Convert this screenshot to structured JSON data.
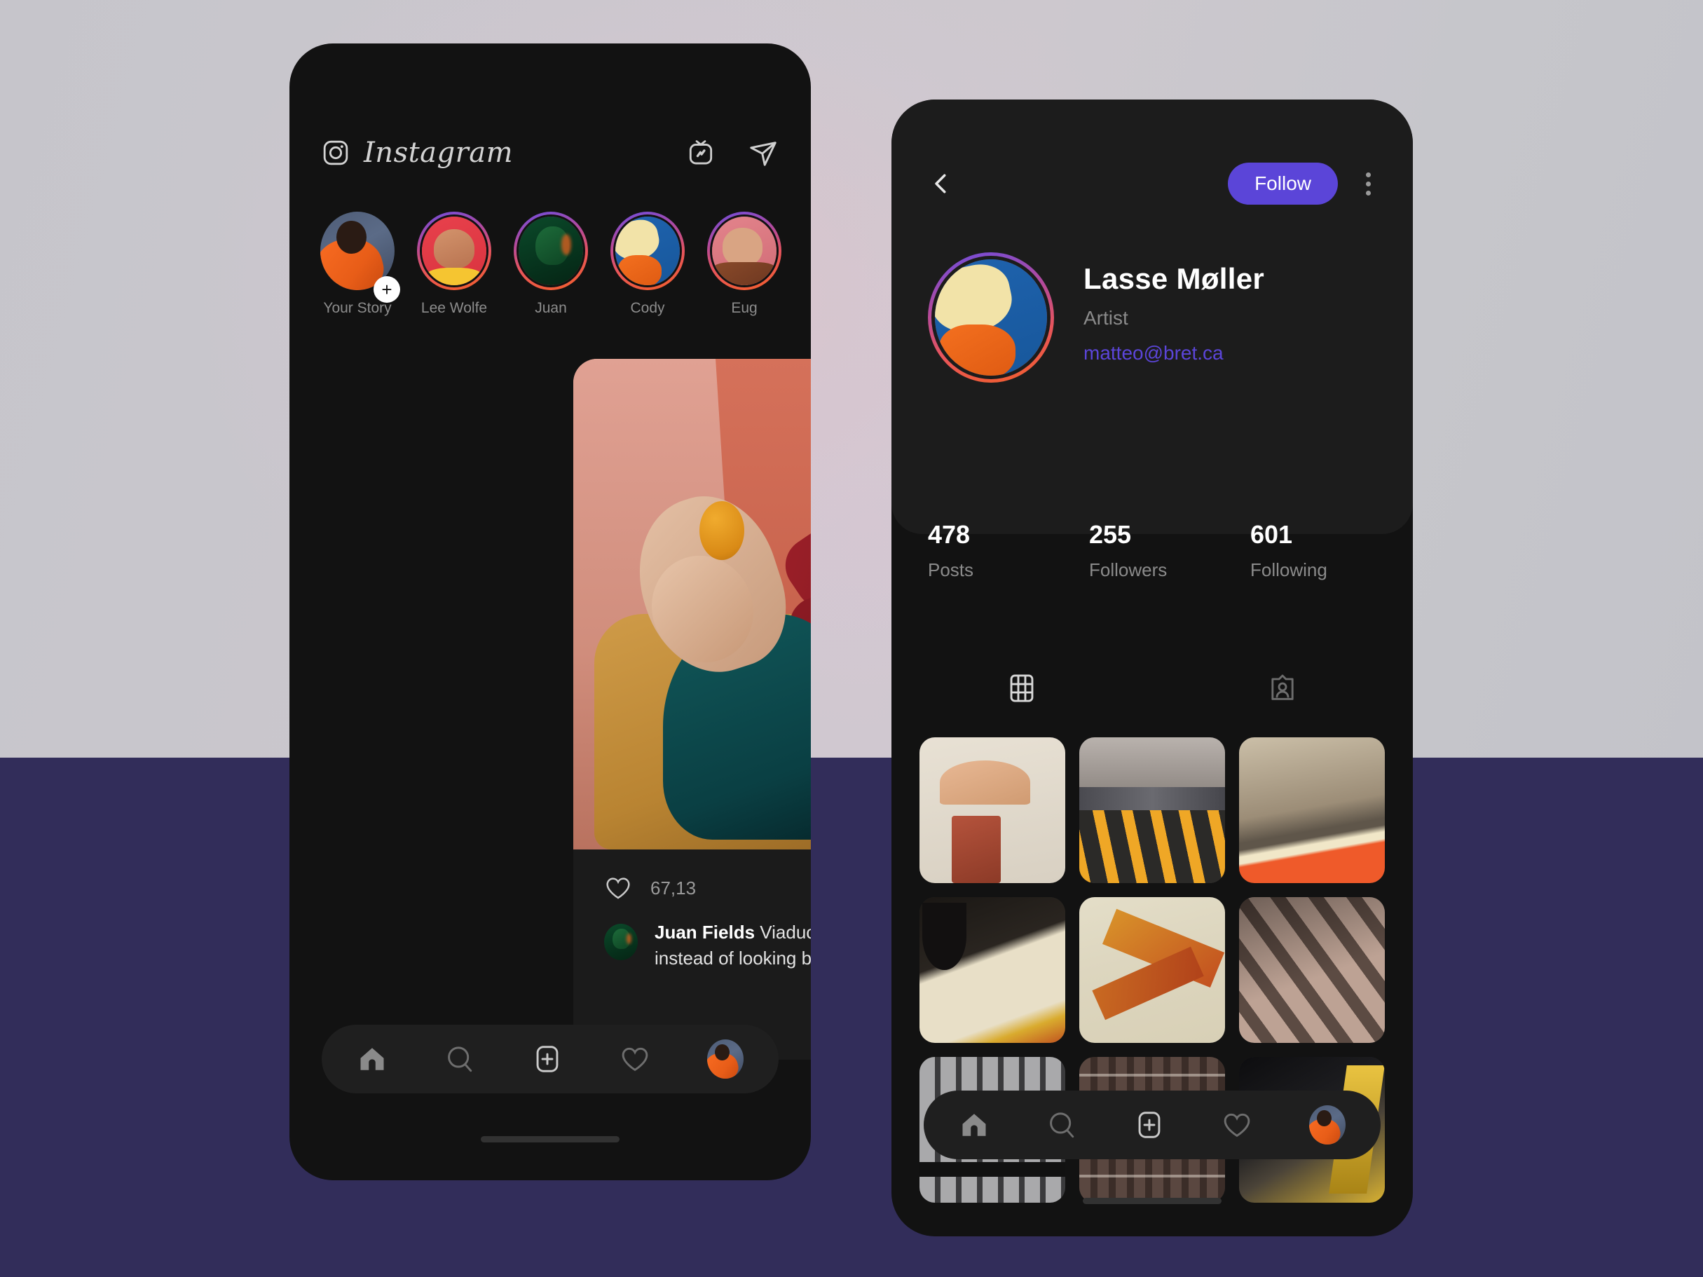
{
  "background": {
    "top_color": "#c9c7ce",
    "bottom_color": "#322d5a"
  },
  "theme": {
    "accent_purple": "#5b45d8",
    "surface_dark": "#121212",
    "card_dark": "#1b1b1b",
    "panel_dark": "#1c1c1c",
    "text_primary": "#ffffff",
    "text_muted": "#8b8b8b",
    "story_ring_gradient": [
      "#6c4de0",
      "#b54a9a",
      "#e8555a",
      "#f25f2a"
    ]
  },
  "feed_screen": {
    "header": {
      "logo_icon": "instagram-camera-icon",
      "wordmark": "Instagram",
      "actions": [
        {
          "icon": "igtv-icon",
          "name": "igtv-button"
        },
        {
          "icon": "send-paper-plane-icon",
          "name": "direct-messages-button"
        }
      ]
    },
    "stories": [
      {
        "label": "Your Story",
        "has_ring": false,
        "has_add_badge": true,
        "add_badge": "+",
        "avatar": "av-you"
      },
      {
        "label": "Lee Wolfe",
        "has_ring": true,
        "has_add_badge": false,
        "avatar": "av-lee"
      },
      {
        "label": "Juan",
        "has_ring": true,
        "has_add_badge": false,
        "avatar": "av-juan"
      },
      {
        "label": "Cody",
        "has_ring": true,
        "has_add_badge": false,
        "avatar": "av-cody"
      },
      {
        "label": "Eug",
        "has_ring": true,
        "has_add_badge": false,
        "avatar": "av-eug"
      }
    ],
    "post": {
      "photo_alt": "woman reclining in mustard armchair holding an orange",
      "likes_count": "67,13",
      "actions": [
        {
          "icon": "heart-icon",
          "name": "like-button"
        },
        {
          "icon": "comment-bubble-icon",
          "name": "comment-button"
        },
        {
          "icon": "send-paper-plane-icon",
          "name": "share-button"
        },
        {
          "icon": "bookmark-icon",
          "name": "save-button"
        }
      ],
      "caption_author": "Juan Fields",
      "caption_text": "Viaduct, Canada Moving forward instead of looking back."
    },
    "bottom_nav": [
      {
        "icon": "home-icon",
        "name": "nav-home",
        "active": true
      },
      {
        "icon": "search-icon",
        "name": "nav-search",
        "active": false
      },
      {
        "icon": "plus-square-icon",
        "name": "nav-create",
        "active": false
      },
      {
        "icon": "heart-icon",
        "name": "nav-activity",
        "active": false
      },
      {
        "icon": "avatar-icon",
        "name": "nav-profile",
        "active": false
      }
    ]
  },
  "profile_screen": {
    "topbar": {
      "back_icon": "chevron-left-icon",
      "follow_label": "Follow",
      "more_icon": "kebab-menu-icon"
    },
    "identity": {
      "name": "Lasse Møller",
      "role": "Artist",
      "email": "matteo@bret.ca",
      "avatar_alt": "two people lying down, orange and yellow hoodies"
    },
    "stats": [
      {
        "value": "478",
        "label": "Posts"
      },
      {
        "value": "255",
        "label": "Followers"
      },
      {
        "value": "601",
        "label": "Following"
      }
    ],
    "tabs": [
      {
        "icon": "grid-icon",
        "name": "tab-grid",
        "active": true
      },
      {
        "icon": "tagged-person-card-icon",
        "name": "tab-tagged",
        "active": false
      }
    ],
    "grid": [
      {
        "alt": "awning over red door on brick building",
        "style": "gc1"
      },
      {
        "alt": "crowded city crosswalk with yellow stripes",
        "style": "gc2"
      },
      {
        "alt": "shop window reflection with orange wall",
        "style": "gc3"
      },
      {
        "alt": "cream curved wall with yellow and red shapes",
        "style": "gc4"
      },
      {
        "alt": "orange and yellow angled paper strips",
        "style": "gc5"
      },
      {
        "alt": "tiled pavement with diagonal shadows",
        "style": "gc6"
      },
      {
        "alt": "metal railing against pale wall",
        "style": "gc7"
      },
      {
        "alt": "checked curtain in dim room",
        "style": "gc8"
      },
      {
        "alt": "yellow tram at night",
        "style": "gc9"
      }
    ],
    "bottom_nav": [
      {
        "icon": "home-icon",
        "name": "nav-home",
        "active": true
      },
      {
        "icon": "search-icon",
        "name": "nav-search",
        "active": false
      },
      {
        "icon": "plus-square-icon",
        "name": "nav-create",
        "active": false
      },
      {
        "icon": "heart-icon",
        "name": "nav-activity",
        "active": false
      },
      {
        "icon": "avatar-icon",
        "name": "nav-profile",
        "active": false
      }
    ]
  }
}
